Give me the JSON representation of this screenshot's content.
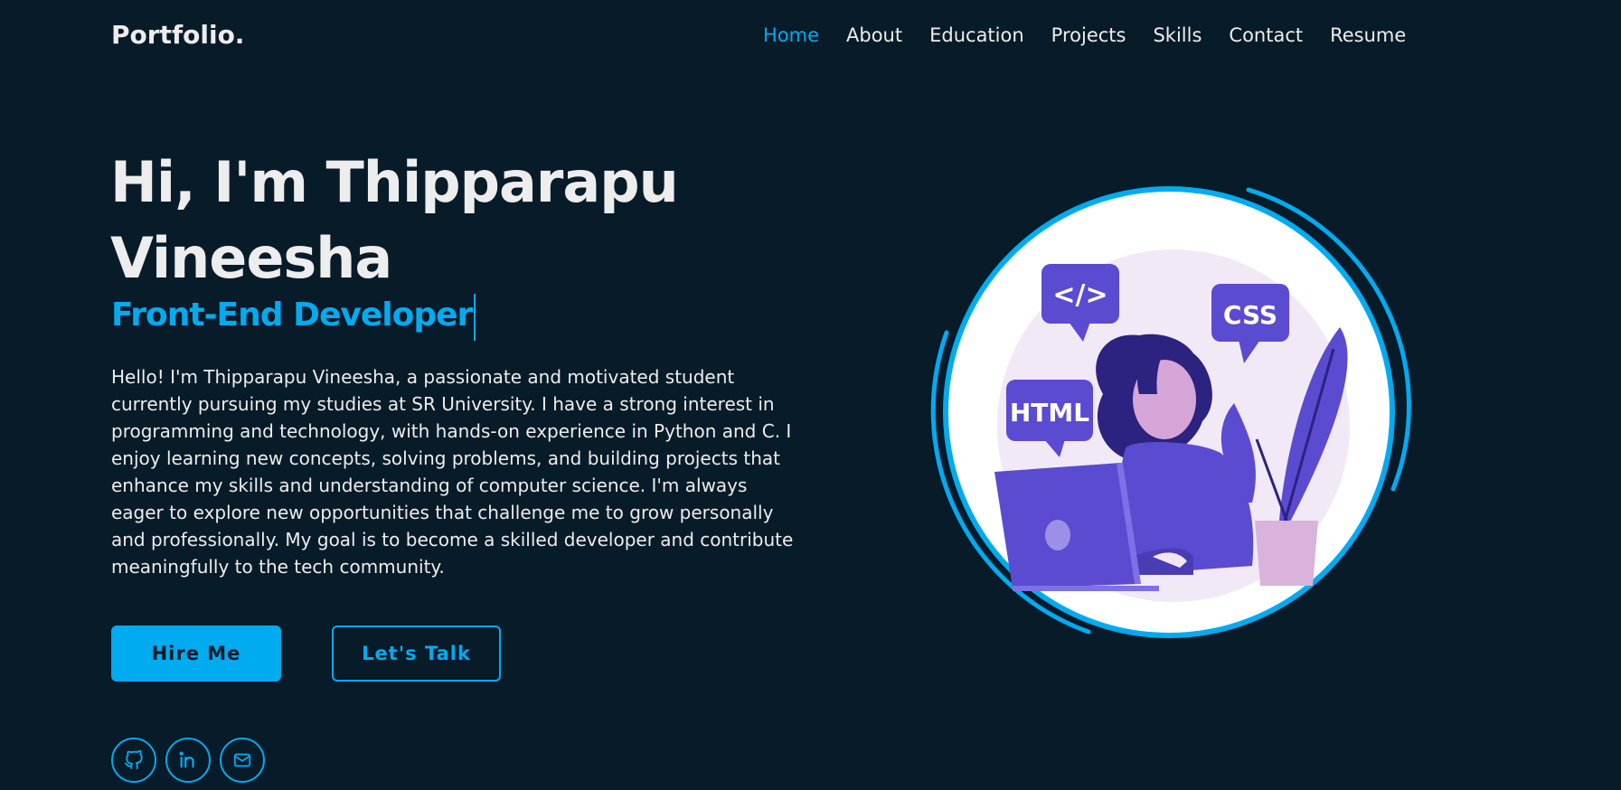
{
  "header": {
    "logo": "Portfolio.",
    "nav": [
      {
        "label": "Home",
        "active": true
      },
      {
        "label": "About"
      },
      {
        "label": "Education"
      },
      {
        "label": "Projects"
      },
      {
        "label": "Skills"
      },
      {
        "label": "Contact"
      },
      {
        "label": "Resume"
      }
    ]
  },
  "hero": {
    "title": "Hi, I'm Thipparapu Vineesha",
    "role": "Front-End Developer",
    "description": "Hello! I'm Thipparapu Vineesha, a passionate and motivated student currently pursuing my studies at SR University. I have a strong interest in programming and technology, with hands-on experience in Python and C. I enjoy learning new concepts, solving problems, and building projects that enhance my skills and understanding of computer science. I'm always eager to explore new opportunities that challenge me to grow personally and professionally. My goal is to become a skilled developer and contribute meaningfully to the tech community.",
    "hire_label": "Hire Me",
    "talk_label": "Let's Talk"
  },
  "socials": [
    {
      "icon": "github-icon"
    },
    {
      "icon": "linkedin-icon"
    },
    {
      "icon": "mail-icon"
    }
  ],
  "illustration": {
    "bubble_code": "</>",
    "bubble_css": "CSS",
    "bubble_html": "HTML"
  },
  "colors": {
    "background": "#081b29",
    "accent": "#00abf0",
    "text": "#ededed",
    "purple": "#5b4bd1"
  }
}
